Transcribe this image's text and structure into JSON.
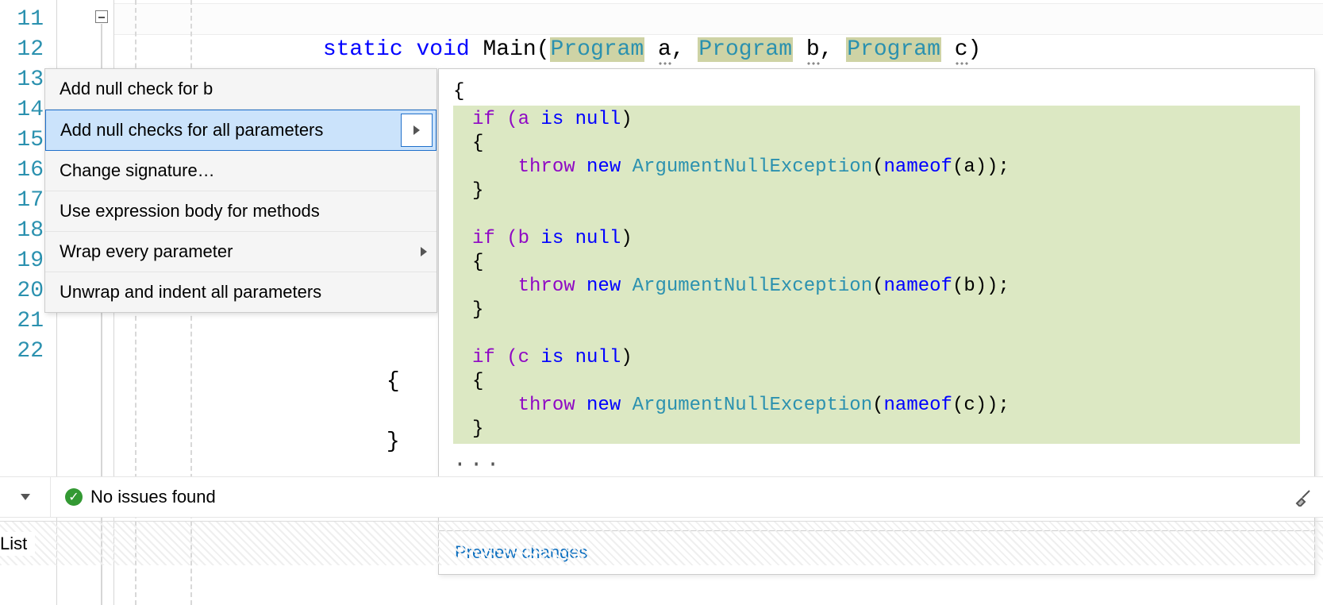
{
  "editor": {
    "line_numbers": [
      "11",
      "12",
      "13",
      "14",
      "15",
      "16",
      "17",
      "18",
      "19",
      "20",
      "21",
      "22"
    ],
    "visible_code": {
      "line11": {
        "kw_static": "static",
        "kw_void": "void",
        "method": "Main",
        "type": "Program",
        "params": [
          "a",
          "b",
          "c"
        ]
      },
      "line19": "{",
      "line20_throw": "throw",
      "line21": "}"
    }
  },
  "quick_actions": {
    "items": [
      {
        "label": "Add null check for b",
        "has_submenu": false,
        "selected": false
      },
      {
        "label": "Add null checks for all parameters",
        "has_submenu": true,
        "selected": true
      },
      {
        "label": "Change signature…",
        "has_submenu": false,
        "selected": false
      },
      {
        "label": "Use expression body for methods",
        "has_submenu": false,
        "selected": false
      },
      {
        "label": "Wrap every parameter",
        "has_submenu": true,
        "selected": false
      },
      {
        "label": "Unwrap and indent all parameters",
        "has_submenu": false,
        "selected": false
      }
    ]
  },
  "preview": {
    "open_brace": "{",
    "blocks": [
      {
        "if_line_pre": "if (a ",
        "if_kw": "is",
        "if_null": "null",
        "if_line_post": ")",
        "open": "{",
        "throw_kw": "throw",
        "new_kw": "new",
        "ex_type": "ArgumentNullException",
        "nameof_kw": "nameof",
        "arg": "a",
        "close": "}"
      },
      {
        "if_line_pre": "if (b ",
        "if_kw": "is",
        "if_null": "null",
        "if_line_post": ")",
        "open": "{",
        "throw_kw": "throw",
        "new_kw": "new",
        "ex_type": "ArgumentNullException",
        "nameof_kw": "nameof",
        "arg": "b",
        "close": "}"
      },
      {
        "if_line_pre": "if (c ",
        "if_kw": "is",
        "if_null": "null",
        "if_line_post": ")",
        "open": "{",
        "throw_kw": "throw",
        "new_kw": "new",
        "ex_type": "ArgumentNullException",
        "nameof_kw": "nameof",
        "arg": "c",
        "close": "}"
      }
    ],
    "ellipsis": "···",
    "footer": "Preview changes"
  },
  "status": {
    "ok_glyph": "✓",
    "health_text": "No issues found"
  },
  "toolwin": {
    "label": "List"
  }
}
